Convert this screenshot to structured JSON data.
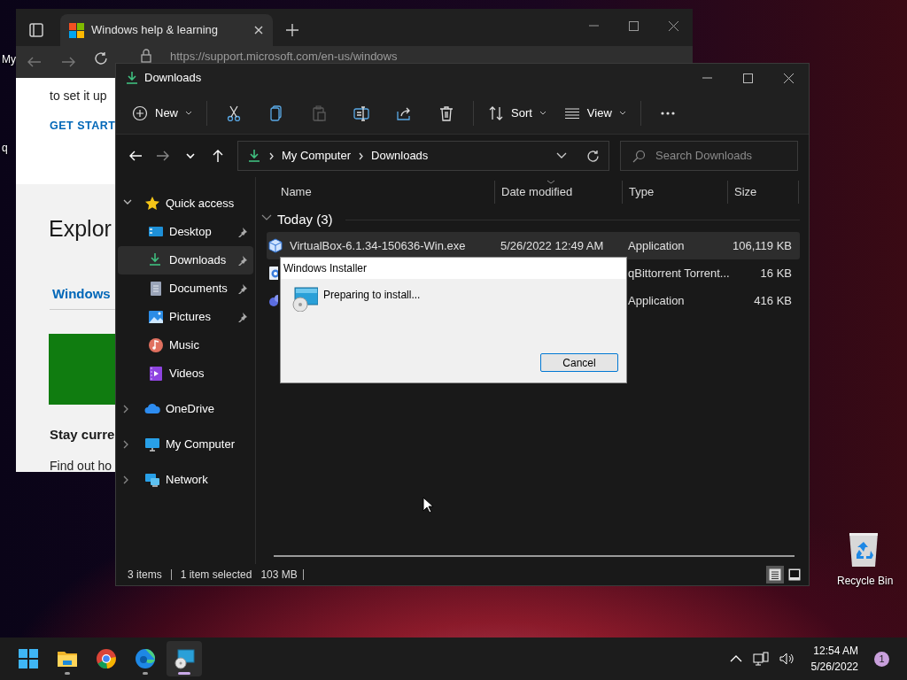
{
  "desktop": {
    "icons": [
      {
        "kind": "partial",
        "label": "My"
      },
      {
        "kind": "partial",
        "label": "q"
      },
      {
        "kind": "recycle",
        "label": "Recycle Bin"
      }
    ]
  },
  "browser": {
    "tab": {
      "title": "Windows help & learning",
      "selected": true
    },
    "url": "https://support.microsoft.com/en-us/windows",
    "page": [
      {
        "kind": "body",
        "text": "to set it up"
      },
      {
        "kind": "link",
        "text": "GET START"
      },
      {
        "kind": "heading",
        "text": "Explor"
      },
      {
        "kind": "tablink",
        "text": "Windows"
      },
      {
        "kind": "banner"
      },
      {
        "kind": "subheading",
        "text": "Stay curre"
      },
      {
        "kind": "body",
        "text": "Find out ho"
      }
    ]
  },
  "explorer": {
    "title": "Downloads",
    "toolbar": [
      {
        "kind": "new",
        "label": "New",
        "disabled": false
      },
      {
        "kind": "cut",
        "disabled": false
      },
      {
        "kind": "copy",
        "disabled": false
      },
      {
        "kind": "paste",
        "disabled": true
      },
      {
        "kind": "rename",
        "disabled": false
      },
      {
        "kind": "share",
        "disabled": false
      },
      {
        "kind": "delete",
        "disabled": false
      },
      {
        "kind": "sort",
        "label": "Sort",
        "disabled": false
      },
      {
        "kind": "view",
        "label": "View",
        "disabled": false
      },
      {
        "kind": "more",
        "disabled": false
      }
    ],
    "nav": {
      "back_disabled": false,
      "forward_disabled": true
    },
    "address": {
      "crumbs": [
        "My Computer",
        "Downloads"
      ]
    },
    "search": {
      "placeholder": "Search Downloads"
    },
    "sidebar": [
      {
        "kind": "star",
        "label": "Quick access",
        "expanded": true,
        "selected": false,
        "children": [
          {
            "kind": "desktop",
            "label": "Desktop",
            "pinned": true,
            "selected": false
          },
          {
            "kind": "downloads",
            "label": "Downloads",
            "pinned": true,
            "selected": true
          },
          {
            "kind": "documents",
            "label": "Documents",
            "pinned": true,
            "selected": false
          },
          {
            "kind": "pictures",
            "label": "Pictures",
            "pinned": true,
            "selected": false
          },
          {
            "kind": "music",
            "label": "Music",
            "pinned": false,
            "selected": false
          },
          {
            "kind": "videos",
            "label": "Videos",
            "pinned": false,
            "selected": false
          }
        ]
      },
      {
        "kind": "cloud",
        "label": "OneDrive",
        "expanded": false,
        "selected": false
      },
      {
        "kind": "computer",
        "label": "My Computer",
        "expanded": false,
        "selected": false
      },
      {
        "kind": "network",
        "label": "Network",
        "expanded": false,
        "selected": false
      }
    ],
    "columns": [
      "Name",
      "Date modified",
      "Type",
      "Size"
    ],
    "group": {
      "label": "Today (3)",
      "expanded": true
    },
    "rows": [
      {
        "kind": "box",
        "name": "VirtualBox-6.1.34-150636-Win.exe",
        "date": "5/26/2022 12:49 AM",
        "type": "Application",
        "size": "106,119 KB",
        "selected": true
      },
      {
        "kind": "torrent",
        "type": "qBittorrent Torrent...",
        "size": "16 KB",
        "selected": false
      },
      {
        "kind": "app",
        "type": "Application",
        "size": "416 KB",
        "selected": false
      }
    ],
    "status": [
      "3 items",
      "1 item selected",
      "103 MB"
    ],
    "views": [
      {
        "kind": "details",
        "selected": true
      },
      {
        "kind": "tiles",
        "selected": false
      }
    ]
  },
  "dialog": {
    "title": "Windows Installer",
    "message": "Preparing to install...",
    "button": "Cancel"
  },
  "taskbar": {
    "apps": [
      {
        "kind": "start",
        "running": false,
        "active": false
      },
      {
        "kind": "folder",
        "running": true,
        "active": false
      },
      {
        "kind": "chrome",
        "running": false,
        "active": false
      },
      {
        "kind": "edge",
        "running": true,
        "active": false
      },
      {
        "kind": "installer",
        "running": true,
        "active": true
      }
    ],
    "time": "12:54 AM",
    "date": "5/26/2022",
    "badge": "1"
  }
}
